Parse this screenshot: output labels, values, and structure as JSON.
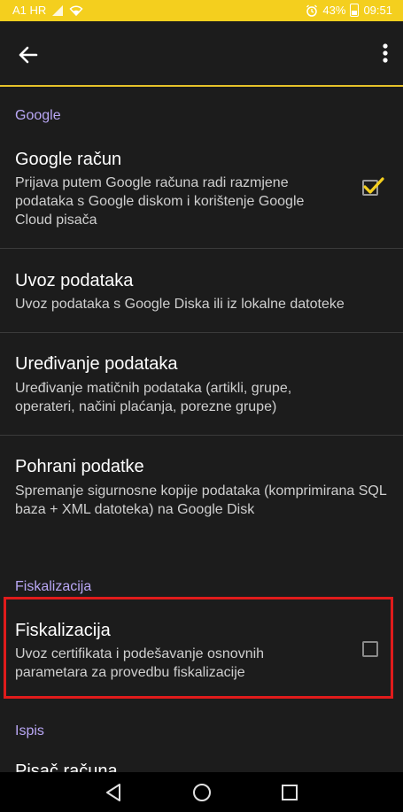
{
  "status_bar": {
    "carrier": "A1 HR",
    "battery": "43%",
    "time": "09:51",
    "icons": [
      "signal-icon",
      "wifi-icon",
      "alarm-icon",
      "battery-icon"
    ]
  },
  "app_bar": {
    "back_icon": "arrow-left-icon",
    "menu_icon": "more-vertical-icon"
  },
  "sections": {
    "google": {
      "header": "Google",
      "items": [
        {
          "title": "Google račun",
          "summary": "Prijava putem Google računa radi razmjene podataka s Google diskom i korištenje Google Cloud pisača",
          "checked": true
        },
        {
          "title": "Uvoz podataka",
          "summary": "Uvoz podataka s Google Diska ili iz lokalne datoteke"
        },
        {
          "title": "Uređivanje podataka",
          "summary": "Uređivanje matičnih podataka (artikli, grupe, operateri, načini plaćanja, porezne grupe)"
        },
        {
          "title": "Pohrani podatke",
          "summary": "Spremanje sigurnosne kopije podataka (komprimirana SQL baza + XML datoteka) na Google Disk"
        }
      ]
    },
    "fiskalizacija": {
      "header": "Fiskalizacija",
      "items": [
        {
          "title": "Fiskalizacija",
          "summary": "Uvoz certifikata i podešavanje osnovnih parametara za provedbu fiskalizacije",
          "checked": false
        }
      ]
    },
    "ispis": {
      "header": "Ispis",
      "items": [
        {
          "title": "Pisač računa"
        }
      ]
    }
  },
  "nav_bar": {
    "icons": [
      "back-triangle-icon",
      "home-circle-icon",
      "recents-square-icon"
    ]
  },
  "colors": {
    "status_bar": "#f4cf1e",
    "accent_line": "#e6c22a",
    "section_header": "#b9a7f5",
    "highlight": "#e01b1b",
    "check_mark": "#f4cf1e"
  }
}
